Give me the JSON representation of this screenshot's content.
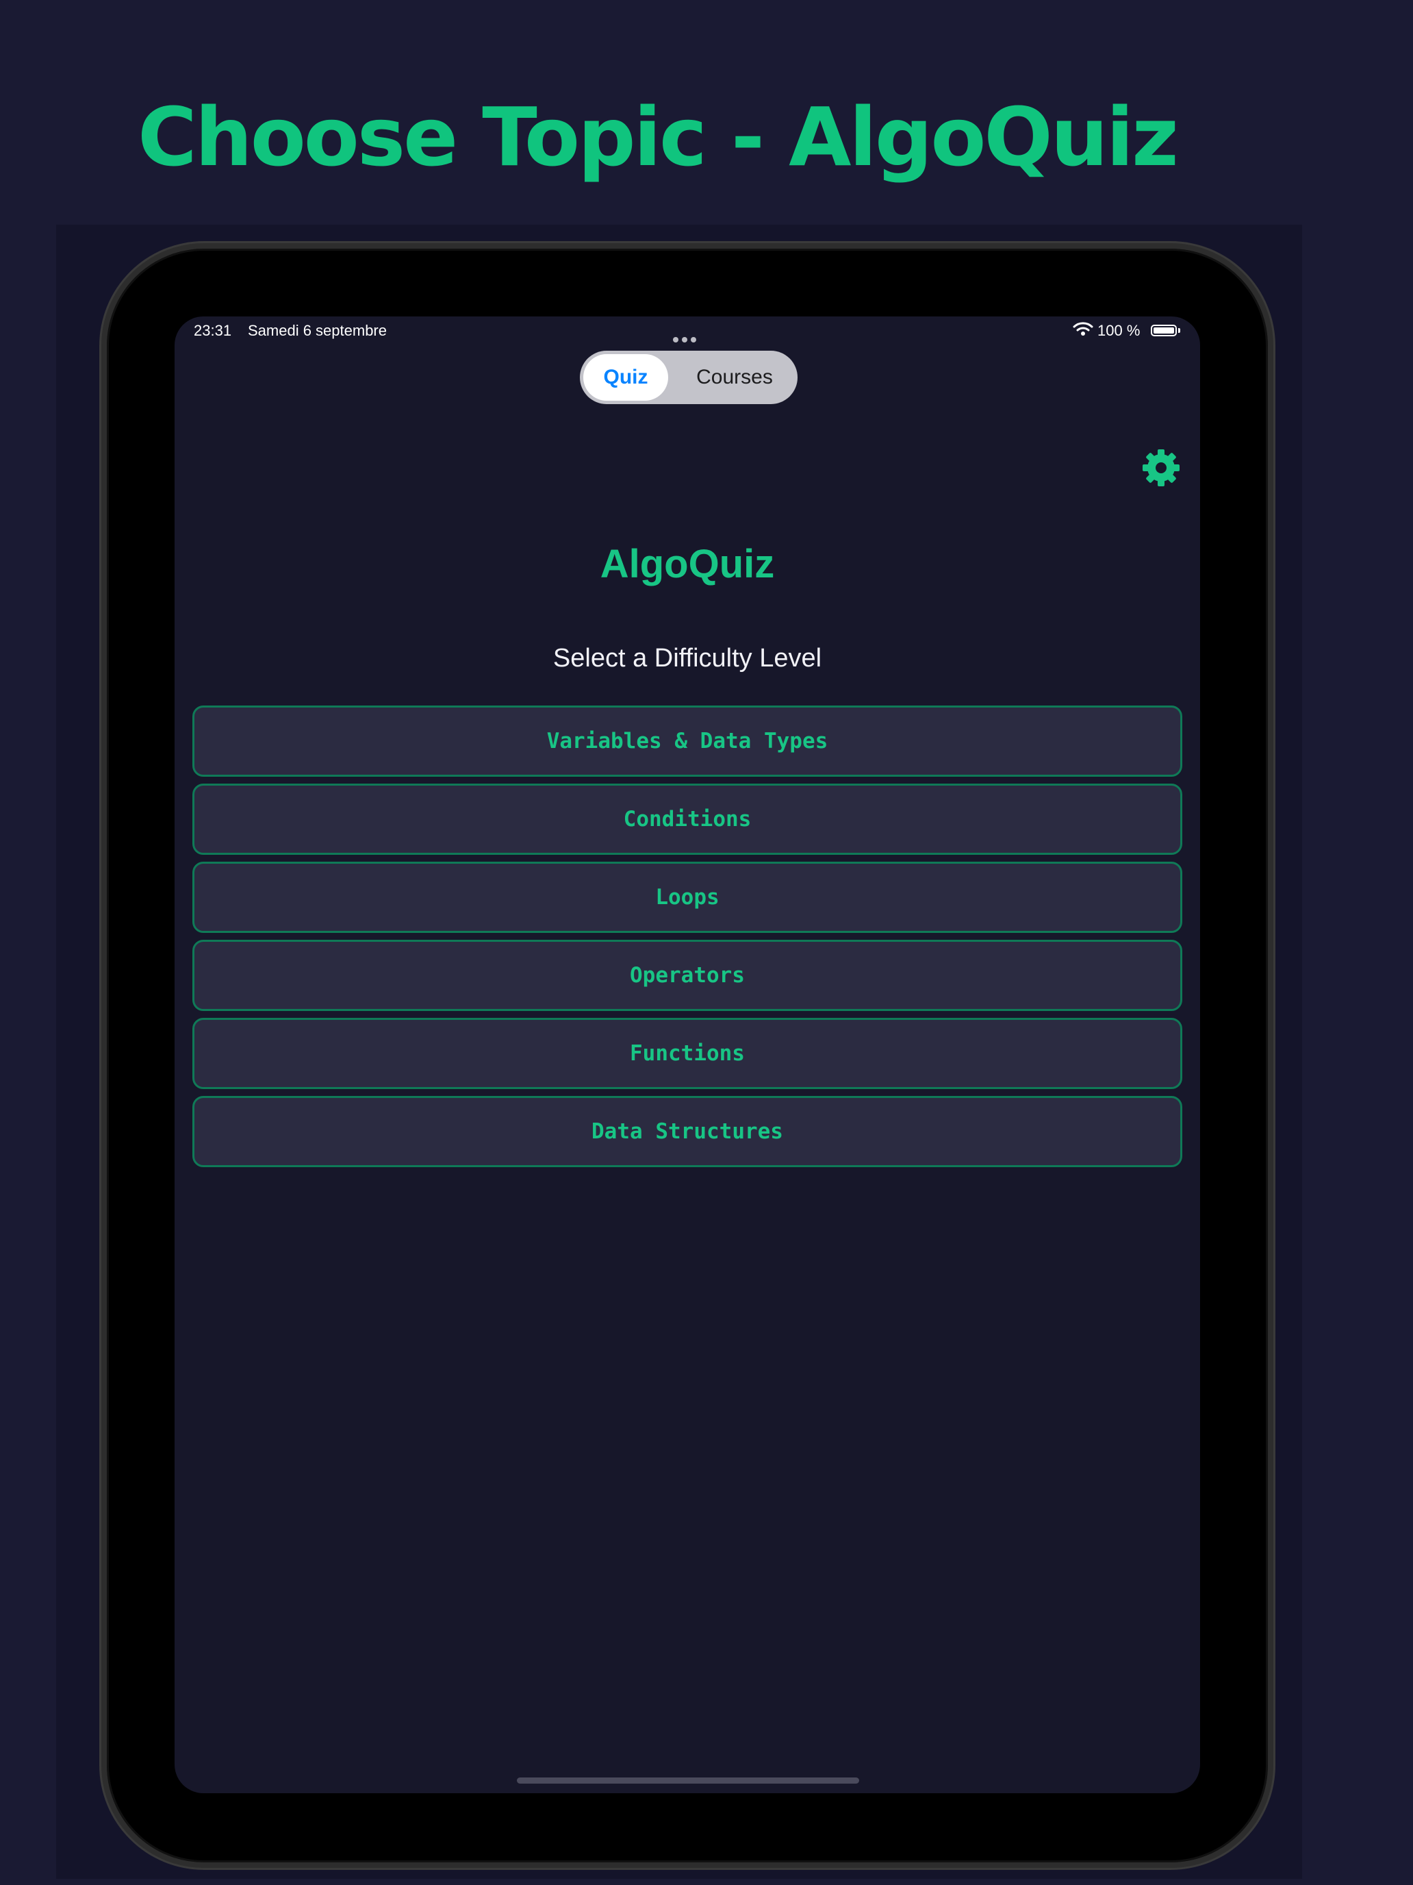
{
  "promo": {
    "title": "Choose Topic - AlgoQuiz"
  },
  "status_bar": {
    "time": "23:31",
    "date": "Samedi 6 septembre",
    "battery_percent": "100 %",
    "battery_level": 1.0
  },
  "segmented_control": {
    "options": [
      "Quiz",
      "Courses"
    ],
    "selected": "Quiz"
  },
  "header": {
    "settings_icon": "gear-icon"
  },
  "main": {
    "app_title": "AlgoQuiz",
    "subtitle": "Select a Difficulty Level",
    "topics": [
      "Variables & Data Types",
      "Conditions",
      "Loops",
      "Operators",
      "Functions",
      "Data Structures"
    ]
  },
  "colors": {
    "background": "#1a1a33",
    "screen_background": "#17172a",
    "accent": "#18c585",
    "button_background": "#2b2b41",
    "button_border": "#0f7a57",
    "segment_selected_text": "#0a84ff"
  }
}
